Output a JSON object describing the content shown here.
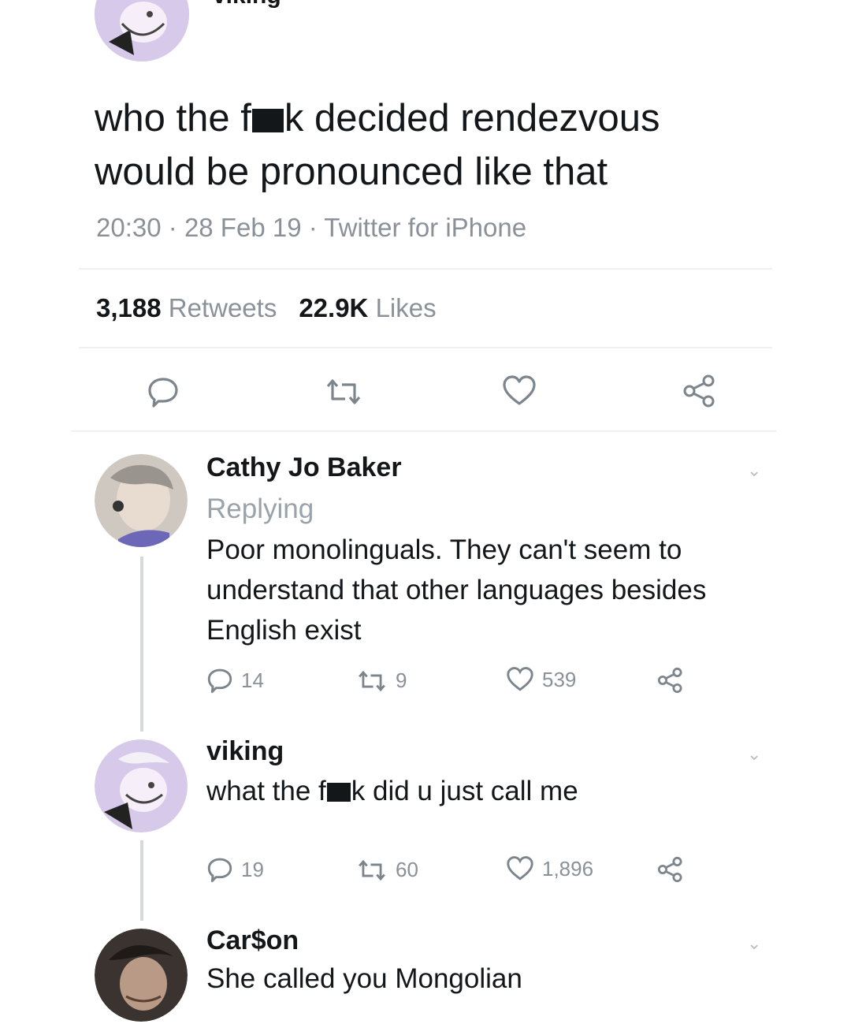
{
  "main_tweet": {
    "author": "viking",
    "text_line1_a": "who the f",
    "text_line1_b": "k decided rendezvous",
    "text_line2": "would be pronounced like that",
    "time": "20:30",
    "date": "28 Feb 19",
    "source": "Twitter for iPhone",
    "retweets_count": "3,188",
    "retweets_label": "Retweets",
    "likes_count": "22.9K",
    "likes_label": "Likes",
    "icons": [
      "reply-icon",
      "retweet-icon",
      "like-icon",
      "share-icon"
    ]
  },
  "replies": [
    {
      "name": "Cathy Jo Baker",
      "replying": "Replying",
      "text_lines": [
        "Poor monolinguals. They can't seem to",
        "understand that other languages besides",
        "English exist"
      ],
      "reply_count": "14",
      "retweet_count": "9",
      "like_count": "539"
    },
    {
      "name": "viking",
      "text_a": "what the f",
      "text_b": "k did u just call me",
      "reply_count": "19",
      "retweet_count": "60",
      "like_count": "1,896"
    },
    {
      "name": "Car$on",
      "text": "She called you Mongolian"
    }
  ],
  "colors": {
    "text": "#14171a",
    "muted": "#8a9198",
    "divider": "#eef0f2",
    "thread_line": "#d6dade",
    "avatar_lavender": "#d7c9ea"
  }
}
